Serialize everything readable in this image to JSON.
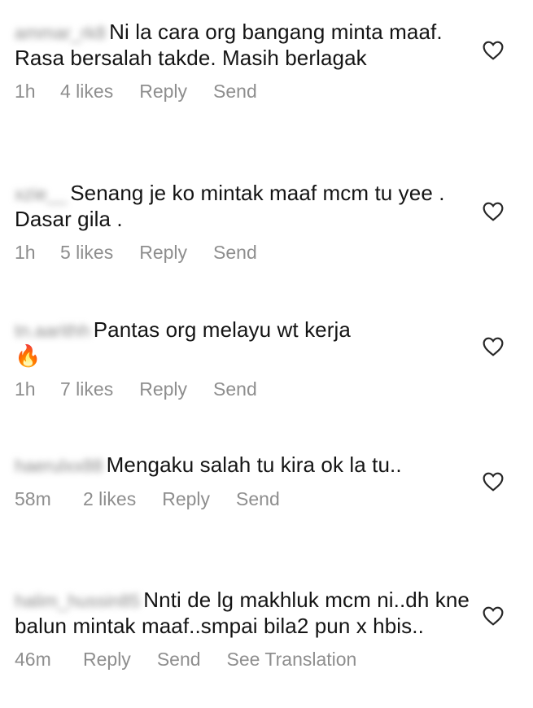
{
  "comments": [
    {
      "username": "ammar_rk8",
      "text": "Ni la cara org bangang minta maaf. Rasa bersalah takde. Masih berlagak",
      "time": "1h",
      "likes": "4 likes",
      "reply": "Reply",
      "send": "Send"
    },
    {
      "username": "xzie__",
      "text": "Senang je ko mintak maaf mcm tu yee . Dasar gila .",
      "time": "1h",
      "likes": "5 likes",
      "reply": "Reply",
      "send": "Send"
    },
    {
      "username": "tn.aarithh",
      "text": "Pantas org melayu wt kerja",
      "emoji": "🔥",
      "time": "1h",
      "likes": "7 likes",
      "reply": "Reply",
      "send": "Send"
    },
    {
      "username": "haerulxx88",
      "text": "Mengaku salah tu kira ok la tu..",
      "time": "58m",
      "likes": "2 likes",
      "reply": "Reply",
      "send": "Send"
    },
    {
      "username": "halim_hussin85",
      "text": "Nnti de lg makhluk mcm ni..dh kne balun mintak maaf..smpai bila2 pun x hbis..",
      "time": "46m",
      "reply": "Reply",
      "send": "Send",
      "translate": "See Translation"
    }
  ],
  "icons": {
    "like": "heart-outline-icon"
  },
  "colors": {
    "text": "#141414",
    "meta": "#8e8e8e",
    "background": "#ffffff"
  }
}
